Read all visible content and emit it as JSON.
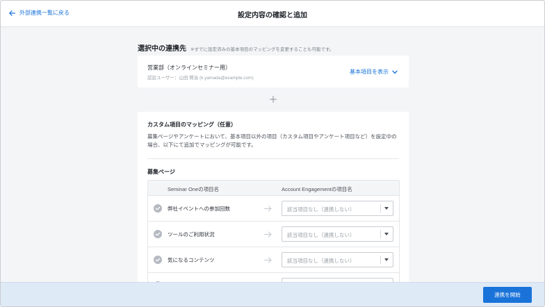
{
  "header": {
    "back_label": "外部連携一覧に戻る",
    "title": "設定内容の確認と追加"
  },
  "selected_connection": {
    "title": "選択中の連携先",
    "note": "※すでに設定済みの基本項目のマッピングを変更することも可能です。",
    "name": "営業部（オンラインセミナー用）",
    "user": "認証ユーザー：山田 賢治 (k.yamada@example.com)",
    "show_items_label": "基本項目を表示"
  },
  "custom_mapping": {
    "title": "カスタム項目のマッピング（任意）",
    "description": "募集ページやアンケートにおいて、基本項目以外の項目（カスタム項目やアンケート項目など）を設定中の場合、以下にて追加でマッピングが可能です。",
    "subsection_title": "募集ページ",
    "col_source": "Seminar Oneの項目名",
    "col_target": "Account Engagementの項目名",
    "rows": [
      {
        "label": "弊社イベントへの参加回数",
        "selected": "該当項目なし（連携しない）"
      },
      {
        "label": "ツールのご利用状況",
        "selected": "該当項目なし（連携しない）"
      },
      {
        "label": "気になるコンテンツ",
        "selected": "該当項目なし（連携しない）"
      },
      {
        "label": "",
        "selected": ""
      }
    ]
  },
  "footer": {
    "start_label": "連携を開始"
  },
  "colors": {
    "accent": "#1a73d9",
    "footer_bg": "#dfeaf7",
    "page_bg": "#f4f5f7"
  }
}
